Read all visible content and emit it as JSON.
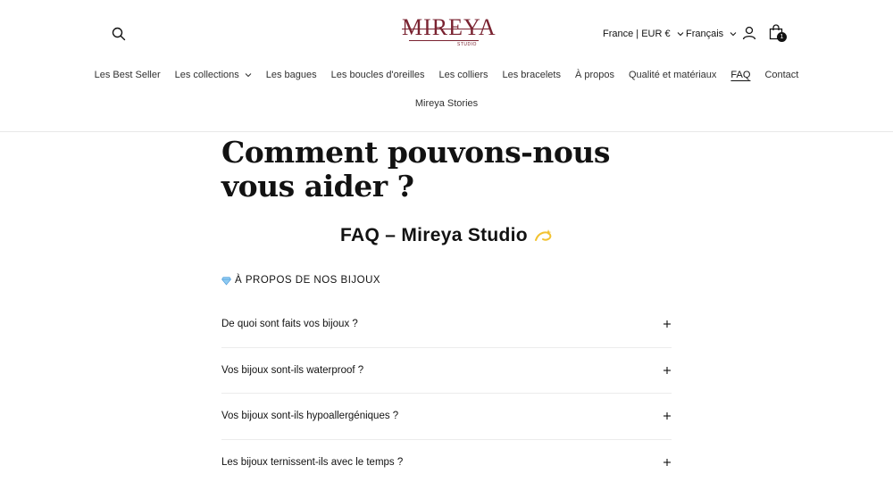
{
  "header": {
    "logo": {
      "word": "MIREYA",
      "sub": "STUDIO"
    },
    "country_selector": "France | EUR €",
    "language_selector": "Français",
    "cart_count": "1",
    "icons": [
      "search-icon",
      "account-icon",
      "cart-icon",
      "chevron-down-icon"
    ]
  },
  "nav": {
    "row1": [
      {
        "label": "Les Best Seller"
      },
      {
        "label": "Les collections",
        "has_dropdown": true
      },
      {
        "label": "Les bagues"
      },
      {
        "label": "Les boucles d'oreilles"
      },
      {
        "label": "Les colliers"
      },
      {
        "label": "Les bracelets"
      },
      {
        "label": "À propos"
      },
      {
        "label": "Qualité et matériaux"
      },
      {
        "label": "FAQ",
        "active": true
      },
      {
        "label": "Contact"
      }
    ],
    "row2": [
      {
        "label": "Mireya Stories"
      }
    ]
  },
  "main": {
    "title": "Comment pouvons-nous vous aider ?",
    "faq_heading": "FAQ – Mireya Studio",
    "section_label": "À PROPOS DE NOS BIJOUX",
    "questions": [
      {
        "q": "De quoi sont faits vos bijoux ?"
      },
      {
        "q": "Vos bijoux sont-ils waterproof ?"
      },
      {
        "q": "Vos bijoux sont-ils hypoallergéniques ?"
      },
      {
        "q": "Les bijoux ternissent-ils avec le temps ?"
      }
    ]
  },
  "colors": {
    "brand": "#7a2331",
    "text": "#121212",
    "divider": "#ececec",
    "sparkle": "#f2c230",
    "gem": "#5aa9e6"
  }
}
